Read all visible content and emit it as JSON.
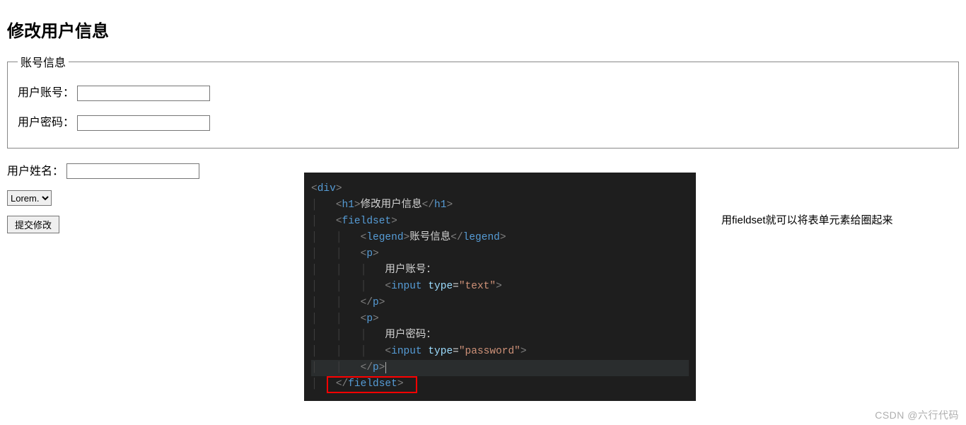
{
  "heading": "修改用户信息",
  "fieldset_legend": "账号信息",
  "labels": {
    "account": "用户账号：",
    "password": "用户密码：",
    "name": "用户姓名：",
    "select_option": "Lorem.",
    "submit": "提交修改"
  },
  "annotation": "用fieldset就可以将表单元素给圈起来",
  "watermark": "CSDN @六行代码",
  "code": {
    "l1_open": "div",
    "l2_open": "h1",
    "l2_txt": "修改用户信息",
    "l2_close": "h1",
    "l3_open": "fieldset",
    "l4_open": "legend",
    "l4_txt": "账号信息",
    "l4_close": "legend",
    "l5_open": "p",
    "l6_txt": "用户账号：",
    "l7_tag": "input",
    "l7_attr": "type",
    "l7_val": "\"text\"",
    "l8_close": "p",
    "l9_open": "p",
    "l10_txt": "用户密码：",
    "l11_tag": "input",
    "l11_attr": "type",
    "l11_val": "\"password\"",
    "l12_close": "p",
    "l13_close": "fieldset"
  }
}
